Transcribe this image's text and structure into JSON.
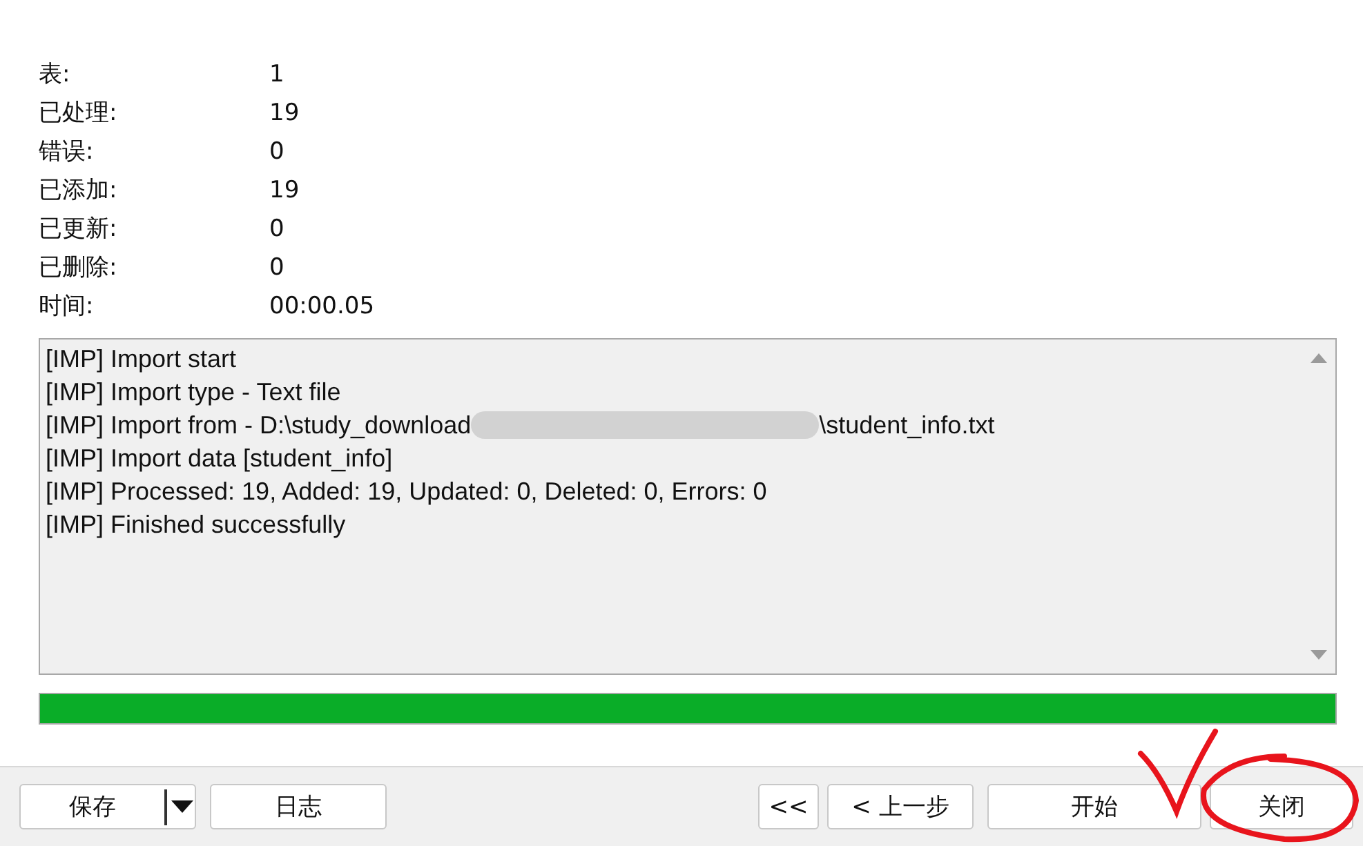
{
  "stats": [
    {
      "label": "表:",
      "value": "1"
    },
    {
      "label": "已处理:",
      "value": "19"
    },
    {
      "label": "错误:",
      "value": "0"
    },
    {
      "label": "已添加:",
      "value": "19"
    },
    {
      "label": "已更新:",
      "value": "0"
    },
    {
      "label": "已删除:",
      "value": "0"
    },
    {
      "label": "时间:",
      "value": "00:00.05"
    }
  ],
  "log": [
    {
      "text": "[IMP] Import start",
      "redacted": false
    },
    {
      "text": "[IMP] Import type - Text file",
      "redacted": false
    },
    {
      "text": "[IMP] Import from - D:\\study_download",
      "redacted": true,
      "after": "\\student_info.txt"
    },
    {
      "text": "[IMP] Import data [student_info]",
      "redacted": false
    },
    {
      "text": "[IMP] Processed: 19, Added: 19, Updated: 0, Deleted: 0, Errors: 0",
      "redacted": false
    },
    {
      "text": "[IMP] Finished successfully",
      "redacted": false
    }
  ],
  "progress": {
    "level": 1
  },
  "buttons_left": [
    {
      "label": "保存",
      "kind": "split"
    },
    {
      "label": "日志",
      "kind": "plain"
    }
  ],
  "buttons_right": [
    {
      "label": "<<",
      "kind": "plain"
    },
    {
      "label": "< 上一步",
      "kind": "plain"
    },
    {
      "label": "开始",
      "kind": "plain"
    },
    {
      "label": "关闭",
      "kind": "plain"
    }
  ],
  "annotation": {
    "kind": "check-circle"
  }
}
